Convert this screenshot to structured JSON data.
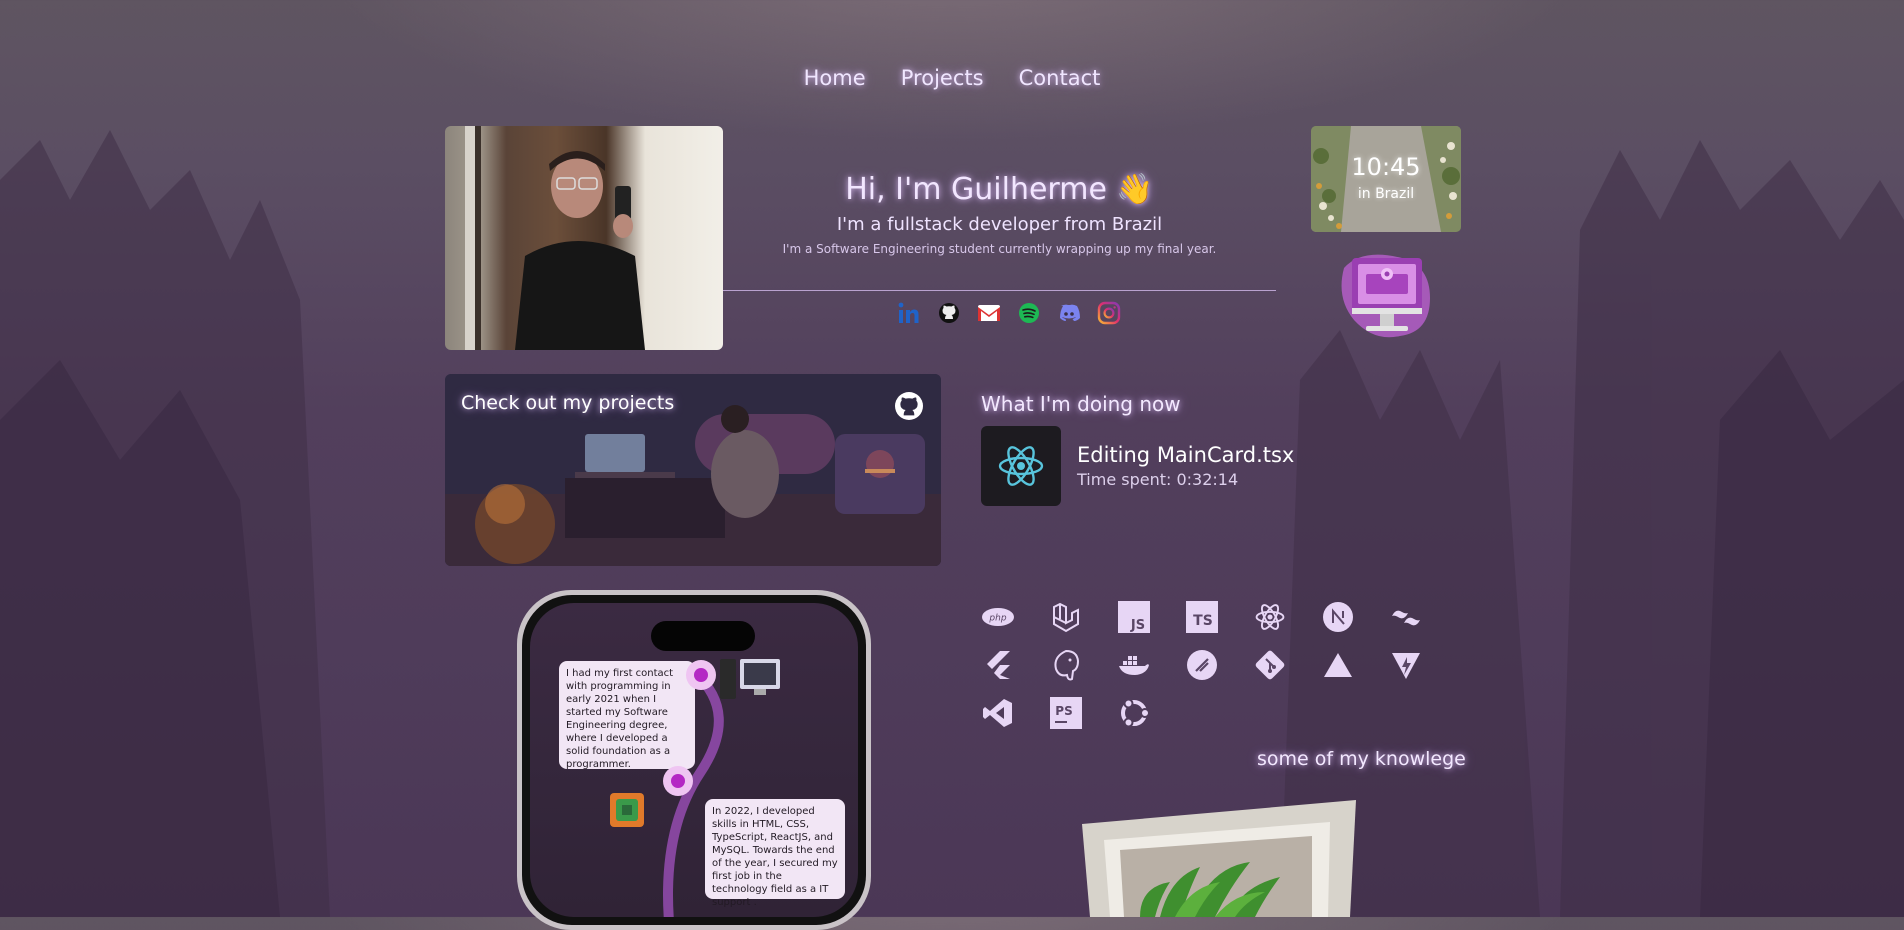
{
  "nav": {
    "items": [
      "Home",
      "Projects",
      "Contact"
    ]
  },
  "intro": {
    "greeting": "Hi, I'm Guilherme 👋",
    "subtitle": "I'm a fullstack developer from Brazil",
    "detail": "I'm a Software Engineering student currently wrapping up my final year."
  },
  "socials": [
    "linkedin-icon",
    "github-icon",
    "gmail-icon",
    "spotify-icon",
    "discord-icon",
    "instagram-icon"
  ],
  "clock": {
    "time": "10:45",
    "location": "in Brazil"
  },
  "projects": {
    "title": "Check out my projects"
  },
  "now": {
    "title": "What I'm doing now",
    "activity": "Editing MainCard.tsx",
    "time_spent": "Time spent: 0:32:14"
  },
  "timeline": [
    "I had my first contact with programming in early 2021 when I started my Software Engineering degree, where I developed a solid foundation as a programmer.",
    "In 2022, I developed skills in HTML, CSS, TypeScript, ReactJS, and MySQL. Towards the end of the year, I secured my first job in the technology field as a IT support ."
  ],
  "skills": [
    "php-icon",
    "laravel-icon",
    "javascript-icon",
    "typescript-icon",
    "react-icon",
    "nextjs-icon",
    "tailwind-icon",
    "flutter-icon",
    "postgresql-icon",
    "docker-icon",
    "swagger-icon",
    "git-icon",
    "vercel-icon",
    "vite-icon",
    "vscode-icon",
    "phpstorm-icon",
    "ubuntu-icon"
  ],
  "skills_caption": "some of my knowlege",
  "colors": {
    "accent": "#e9d5ff",
    "bubble": "#f2e6f5",
    "node": "#b428c4"
  }
}
